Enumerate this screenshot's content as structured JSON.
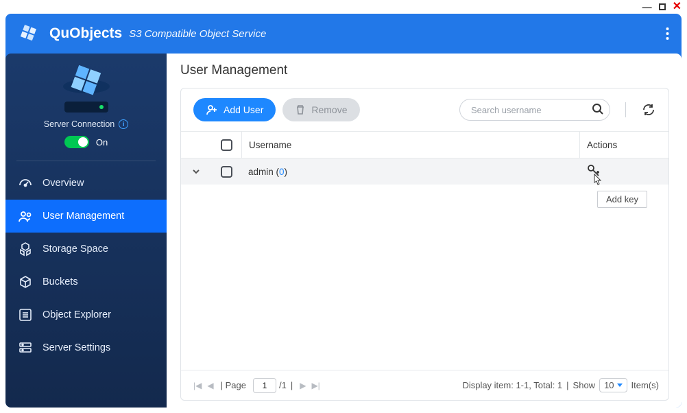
{
  "window": {
    "minimize": "—",
    "close": "✕"
  },
  "header": {
    "title": "QuObjects",
    "subtitle": "S3 Compatible Object Service"
  },
  "server": {
    "connection_label": "Server Connection",
    "toggle_state": "On"
  },
  "sidebar": {
    "items": [
      {
        "label": "Overview"
      },
      {
        "label": "User Management"
      },
      {
        "label": "Storage Space"
      },
      {
        "label": "Buckets"
      },
      {
        "label": "Object Explorer"
      },
      {
        "label": "Server Settings"
      }
    ]
  },
  "page": {
    "title": "User Management"
  },
  "toolbar": {
    "add_user": "Add User",
    "remove": "Remove",
    "search_placeholder": "Search username"
  },
  "table": {
    "col_username": "Username",
    "col_actions": "Actions",
    "rows": [
      {
        "username": "admin",
        "key_count": "0"
      }
    ],
    "tooltip_add_key": "Add key"
  },
  "footer": {
    "page_label_prefix": "Page",
    "page_current": "1",
    "page_total": "/1",
    "display_text": "Display item: 1-1, Total: 1",
    "show_label": "Show",
    "show_value": "10",
    "items_label": "Item(s)"
  }
}
